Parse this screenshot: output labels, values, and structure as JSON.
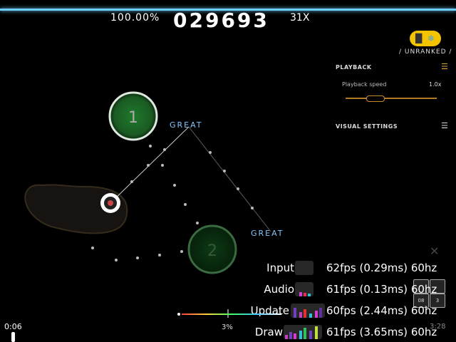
{
  "hud": {
    "accuracy": "100.00%",
    "score": "029693",
    "combo": "31X",
    "ranked_status": "/ UNRANKED /"
  },
  "settings_panel": {
    "playback": {
      "title": "PLAYBACK",
      "speed_label": "Playback speed",
      "speed_value": "1.0x",
      "speed_level": 0.32
    },
    "visual_settings": {
      "title": "VISUAL SETTINGS"
    }
  },
  "playfield": {
    "circles": [
      {
        "number": "1"
      },
      {
        "number": "2"
      }
    ],
    "judgements": [
      "GREAT",
      "GREAT"
    ]
  },
  "fps_counter": {
    "rows": [
      {
        "label": "Input",
        "fps": "62fps",
        "time": "(0.29ms)",
        "refresh": "60hz"
      },
      {
        "label": "Audio",
        "fps": "61fps",
        "time": "(0.13ms)",
        "refresh": "60hz"
      },
      {
        "label": "Update",
        "fps": "60fps",
        "time": "(2.44ms)",
        "refresh": "60hz"
      },
      {
        "label": "Draw",
        "fps": "61fps",
        "time": "(3.65ms)",
        "refresh": "60hz"
      }
    ]
  },
  "song_progress": {
    "elapsed": "0:06",
    "remaining": "3:28",
    "percent": "3%",
    "fraction": 0.03
  },
  "key_counter": {
    "keys": [
      "08",
      "3"
    ]
  },
  "colors": {
    "accent_blue": "#6fd0ff",
    "badge_yellow": "#f4c400",
    "hit_circle_green": "#2ea84a",
    "judgement_great": "#7fc6ff",
    "panel_orange": "#e6a23c"
  },
  "icons": [
    "menu-icon",
    "unranked-badge-icon",
    "close-icon"
  ]
}
